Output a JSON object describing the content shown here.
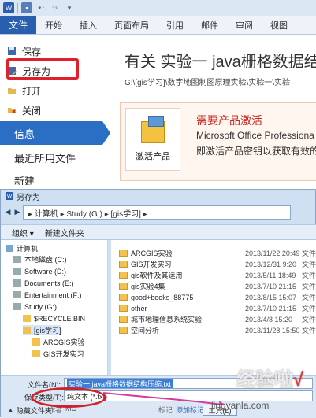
{
  "app": {
    "logo_letter": "W",
    "accent": "#2a5fb0",
    "highlight_color": "#e0202a"
  },
  "ribbon": {
    "file_tab": "文件",
    "tabs": [
      "开始",
      "插入",
      "页面布局",
      "引用",
      "邮件",
      "审阅",
      "视图"
    ]
  },
  "backstage": {
    "menu": {
      "save": "保存",
      "save_as": "另存为",
      "open": "打开",
      "close": "关闭",
      "info": "信息",
      "recent": "最近所用文件",
      "new": "新建"
    },
    "heading": "有关 实验一 java栅格数据结",
    "path": "G:\\[gis学习]\\数字地图制图原理实验\\实验一\\实验",
    "activation": {
      "button_label": "激活产品",
      "title": "需要产品激活",
      "line1": "Microsoft Office Professiona",
      "line2": "即激活产品密钥以获取有效的许"
    }
  },
  "dialog": {
    "title": "另存为",
    "address": "▸ 计算机 ▸ Study (G:) ▸ [gis学习] ▸",
    "toolbar": {
      "organize": "组织 ▾",
      "new_folder": "新建文件夹"
    },
    "tree": [
      {
        "label": "计算机",
        "indent": 1
      },
      {
        "label": "本地磁盘 (C:)",
        "indent": 2
      },
      {
        "label": "Software (D:)",
        "indent": 2
      },
      {
        "label": "Documents (E:)",
        "indent": 2
      },
      {
        "label": "Entertainment (F:)",
        "indent": 2
      },
      {
        "label": "Study (G:)",
        "indent": 2
      },
      {
        "label": "$RECYCLE.BIN",
        "indent": 3
      },
      {
        "label": "[gis学习]",
        "indent": 3
      },
      {
        "label": "ARCGIS实验",
        "indent": 4
      },
      {
        "label": "GIS开发实习",
        "indent": 4
      }
    ],
    "files": [
      {
        "name": "ARCGIS实验",
        "date": "2013/11/22 20:49",
        "type": "文件"
      },
      {
        "name": "GIS开发实习",
        "date": "2013/12/31 9:20",
        "type": "文件"
      },
      {
        "name": "gis软件及其运用",
        "date": "2013/5/11 18:49",
        "type": "文件"
      },
      {
        "name": "gis实验4集",
        "date": "2013/7/10 21:15",
        "type": "文件"
      },
      {
        "name": "good+books_88775",
        "date": "2013/8/15 15:07",
        "type": "文件"
      },
      {
        "name": "other",
        "date": "2013/7/10 21:15",
        "type": "文件"
      },
      {
        "name": "城市地理信息系统实验",
        "date": "2013/4/8 15:20",
        "type": "文件"
      },
      {
        "name": "空间分析",
        "date": "2013/11/28 15:50",
        "type": "文件"
      }
    ],
    "form": {
      "filename_label": "文件名(N):",
      "filename_value": "实验一 java栅格数据结构压缩.txt",
      "type_label": "保存类型(T):",
      "type_value": "纯文本 (*.txt)",
      "author_label": "作者:",
      "author_value": "MC",
      "tags_label": "标记:",
      "tags_value": "添加标记"
    },
    "hide_folders": "隐藏文件夹",
    "tools": "工具(L)"
  },
  "watermark": {
    "text": "经验啦",
    "check": "√",
    "url": "jingyanla.com"
  }
}
